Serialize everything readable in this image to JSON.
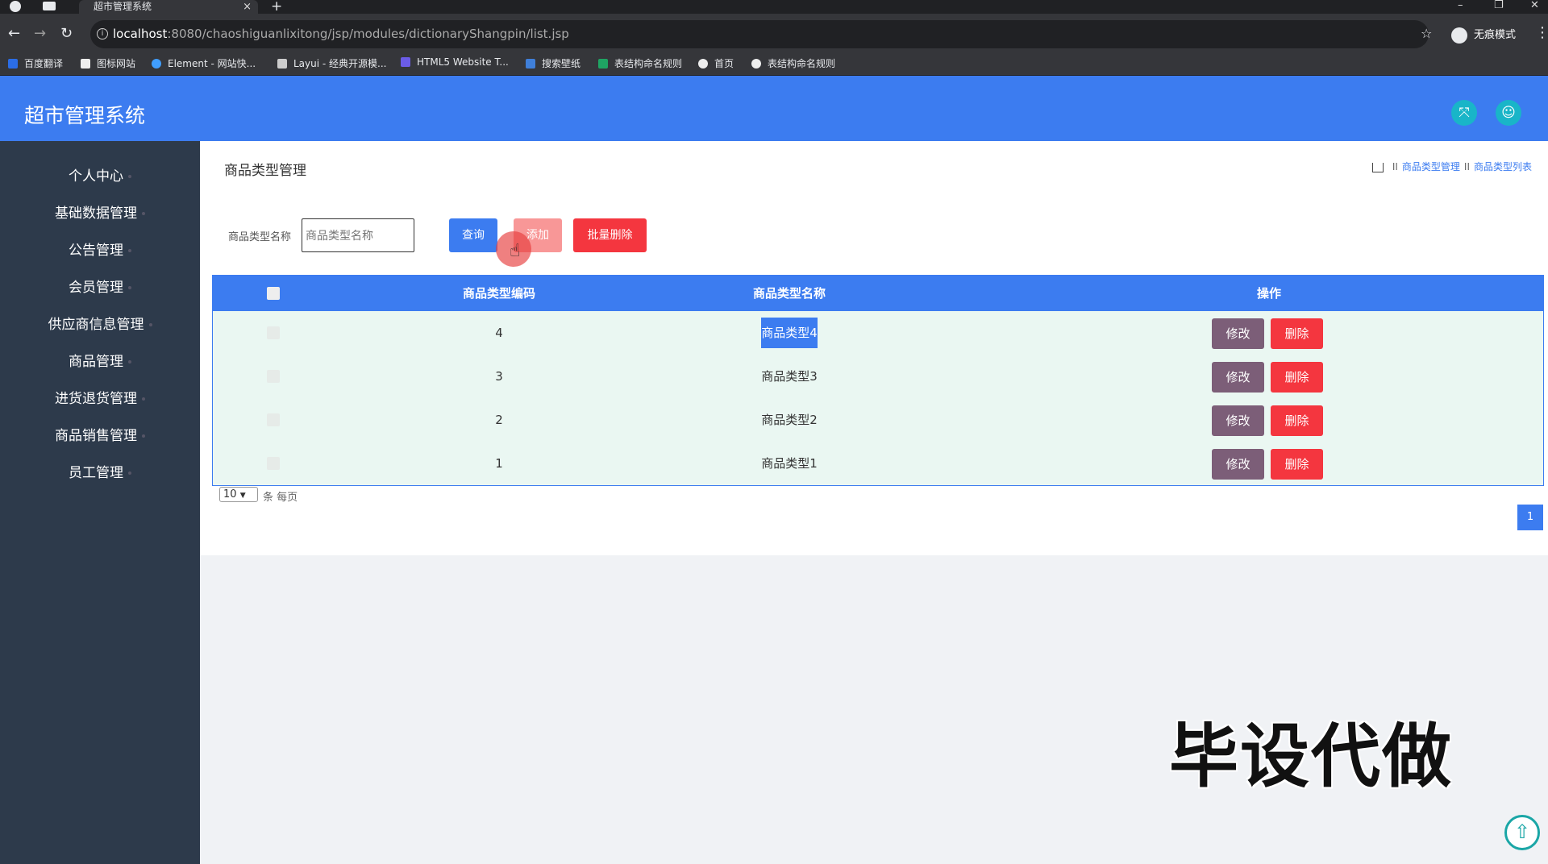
{
  "browser": {
    "tab_title": "超市管理系统",
    "tab_close": "×",
    "new_tab": "+",
    "win_min": "–",
    "win_max": "❐",
    "win_close": "✕",
    "url_host": "localhost",
    "url_path": ":8080/chaoshiguanlixitong/jsp/modules/dictionaryShangpin/list.jsp",
    "profile": "无痕模式",
    "bookmarks": [
      {
        "label": "百度翻译",
        "color": "#2b6de6"
      },
      {
        "label": "图标网站",
        "color": "#eeeeee"
      },
      {
        "label": "Element - 网站快...",
        "color": "#409eff"
      },
      {
        "label": "Layui - 经典开源模...",
        "color": "#cccccc"
      },
      {
        "label": "HTML5 Website T...",
        "color": "#6b5ce7"
      },
      {
        "label": "搜索壁纸",
        "color": "#3f7fd9"
      },
      {
        "label": "表结构命名规则",
        "color": "#1fa463"
      },
      {
        "label": "首页",
        "color": "#eeeeee"
      },
      {
        "label": "表结构命名规则",
        "color": "#eeeeee"
      }
    ]
  },
  "app": {
    "title": "超市管理系统",
    "accent": "#3c7cf0",
    "header_icons": [
      "fullscreen-icon",
      "user-icon"
    ]
  },
  "sidebar": {
    "items": [
      {
        "label": "个人中心"
      },
      {
        "label": "基础数据管理"
      },
      {
        "label": "公告管理"
      },
      {
        "label": "会员管理"
      },
      {
        "label": "供应商信息管理"
      },
      {
        "label": "商品管理"
      },
      {
        "label": "进货退货管理"
      },
      {
        "label": "商品销售管理"
      },
      {
        "label": "员工管理"
      }
    ]
  },
  "page": {
    "title": "商品类型管理",
    "breadcrumb": [
      "商品类型管理",
      "商品类型列表"
    ],
    "breadcrumb_sep": "II",
    "search": {
      "label": "商品类型名称",
      "placeholder": "商品类型名称",
      "value": ""
    },
    "buttons": {
      "search": "查询",
      "add": "添加",
      "batch_delete": "批量删除"
    },
    "table": {
      "columns": [
        "商品类型编码",
        "商品类型名称",
        "操作"
      ],
      "rows": [
        {
          "code": "4",
          "name": "商品类型4",
          "selected_text": true
        },
        {
          "code": "3",
          "name": "商品类型3",
          "selected_text": false
        },
        {
          "code": "2",
          "name": "商品类型2",
          "selected_text": false
        },
        {
          "code": "1",
          "name": "商品类型1",
          "selected_text": false
        }
      ],
      "edit_label": "修改",
      "delete_label": "删除"
    },
    "pagination": {
      "page_size": "10",
      "page_size_label": "条 每页",
      "current_page": "1"
    }
  },
  "overlay": {
    "watermark": "毕设代做"
  }
}
